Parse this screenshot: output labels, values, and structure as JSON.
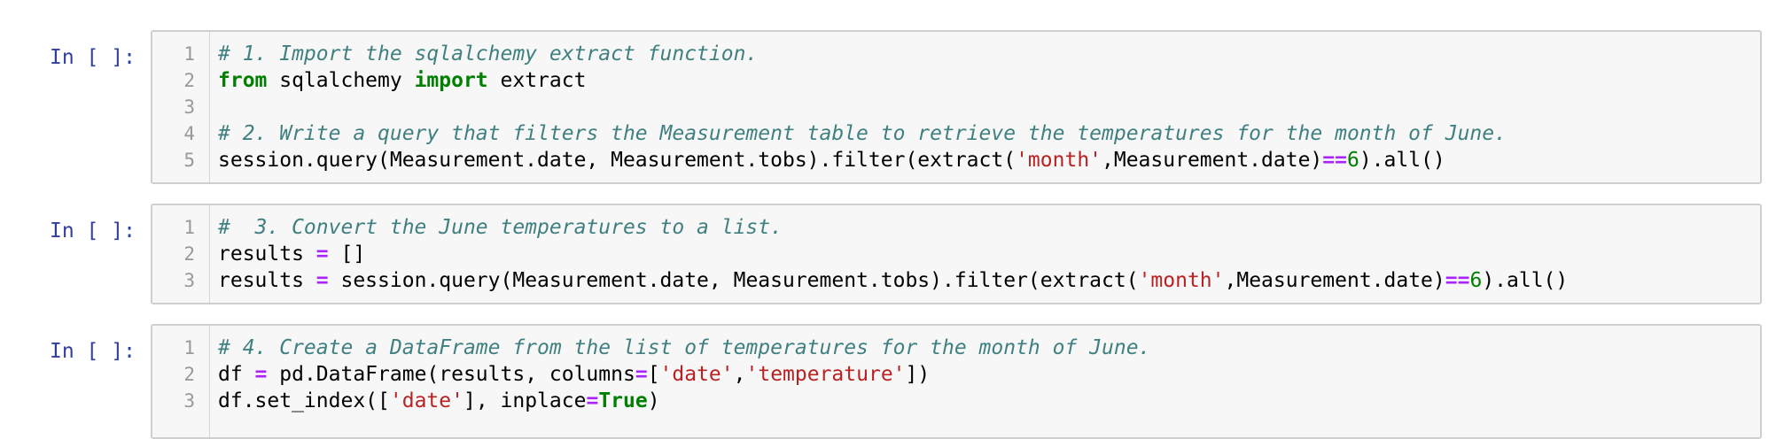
{
  "prompt_label": "In [ ]:",
  "cells": [
    {
      "lines": [
        {
          "num": "1",
          "tokens": [
            {
              "t": "c-comment",
              "v": "# 1. Import the sqlalchemy extract function."
            }
          ]
        },
        {
          "num": "2",
          "tokens": [
            {
              "t": "c-kw",
              "v": "from"
            },
            {
              "t": "",
              "v": " sqlalchemy "
            },
            {
              "t": "c-kw",
              "v": "import"
            },
            {
              "t": "",
              "v": " extract"
            }
          ]
        },
        {
          "num": "3",
          "tokens": []
        },
        {
          "num": "4",
          "tokens": [
            {
              "t": "c-comment",
              "v": "# 2. Write a query that filters the Measurement table to retrieve the temperatures for the month of June."
            }
          ]
        },
        {
          "num": "5",
          "tokens": [
            {
              "t": "",
              "v": "session.query(Measurement.date, Measurement.tobs).filter(extract("
            },
            {
              "t": "c-str",
              "v": "'month'"
            },
            {
              "t": "",
              "v": ",Measurement.date)"
            },
            {
              "t": "c-op",
              "v": "=="
            },
            {
              "t": "c-num",
              "v": "6"
            },
            {
              "t": "",
              "v": ").all()"
            }
          ]
        }
      ]
    },
    {
      "lines": [
        {
          "num": "1",
          "tokens": [
            {
              "t": "c-comment",
              "v": "#  3. Convert the June temperatures to a list."
            }
          ]
        },
        {
          "num": "2",
          "tokens": [
            {
              "t": "",
              "v": "results "
            },
            {
              "t": "c-op",
              "v": "="
            },
            {
              "t": "",
              "v": " []"
            }
          ]
        },
        {
          "num": "3",
          "tokens": [
            {
              "t": "",
              "v": "results "
            },
            {
              "t": "c-op",
              "v": "="
            },
            {
              "t": "",
              "v": " session.query(Measurement.date, Measurement.tobs).filter(extract("
            },
            {
              "t": "c-str",
              "v": "'month'"
            },
            {
              "t": "",
              "v": ",Measurement.date)"
            },
            {
              "t": "c-op",
              "v": "=="
            },
            {
              "t": "c-num",
              "v": "6"
            },
            {
              "t": "",
              "v": ").all()"
            }
          ]
        }
      ]
    },
    {
      "lines": [
        {
          "num": "1",
          "tokens": [
            {
              "t": "c-comment",
              "v": "# 4. Create a DataFrame from the list of temperatures for the month of June."
            }
          ]
        },
        {
          "num": "2",
          "tokens": [
            {
              "t": "",
              "v": "df "
            },
            {
              "t": "c-op",
              "v": "="
            },
            {
              "t": "",
              "v": " pd.DataFrame(results, columns"
            },
            {
              "t": "c-op",
              "v": "="
            },
            {
              "t": "",
              "v": "["
            },
            {
              "t": "c-str",
              "v": "'date'"
            },
            {
              "t": "",
              "v": ","
            },
            {
              "t": "c-str",
              "v": "'temperature'"
            },
            {
              "t": "",
              "v": "])"
            }
          ]
        },
        {
          "num": "3",
          "tokens": [
            {
              "t": "",
              "v": "df.set_index(["
            },
            {
              "t": "c-str",
              "v": "'date'"
            },
            {
              "t": "",
              "v": "], inplace"
            },
            {
              "t": "c-op",
              "v": "="
            },
            {
              "t": "c-kw",
              "v": "True"
            },
            {
              "t": "",
              "v": ")"
            }
          ]
        }
      ]
    }
  ]
}
